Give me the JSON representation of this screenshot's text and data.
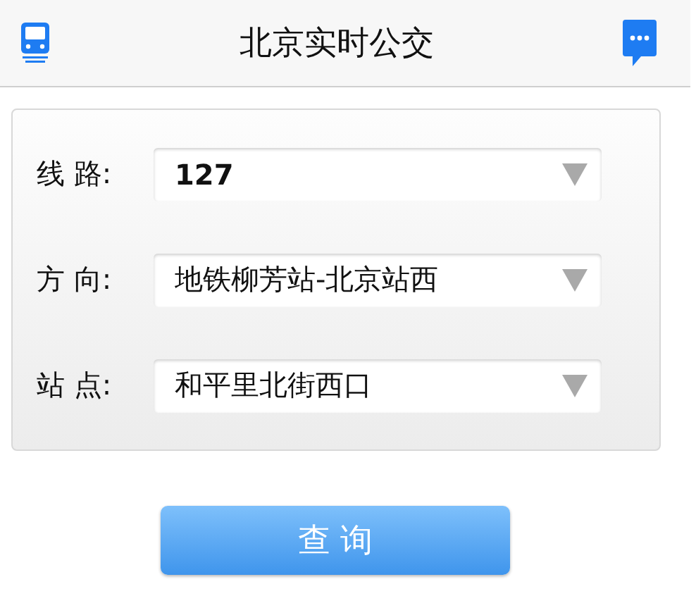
{
  "header": {
    "title": "北京实时公交"
  },
  "fields": [
    {
      "label": "线 路:",
      "value": "127",
      "bold": true
    },
    {
      "label": "方 向:",
      "value": "地铁柳芳站-北京站西",
      "bold": false
    },
    {
      "label": "站 点:",
      "value": "和平里北街西口",
      "bold": false
    }
  ],
  "button": {
    "label": "查 询"
  }
}
